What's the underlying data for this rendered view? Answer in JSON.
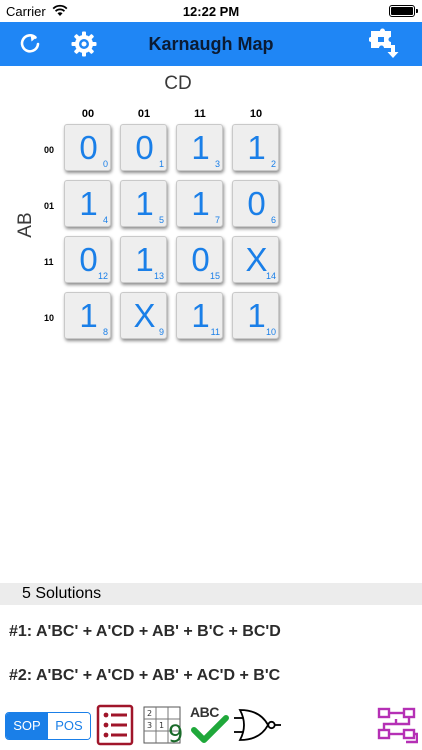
{
  "status_bar": {
    "carrier": "Carrier",
    "time": "12:22 PM"
  },
  "nav": {
    "title": "Karnaugh Map"
  },
  "map": {
    "col_var": "CD",
    "row_var": "AB",
    "col_labels": [
      "00",
      "01",
      "11",
      "10"
    ],
    "row_labels": [
      "00",
      "01",
      "11",
      "10"
    ],
    "cells": [
      [
        {
          "value": "0",
          "index": "0"
        },
        {
          "value": "0",
          "index": "1"
        },
        {
          "value": "1",
          "index": "3"
        },
        {
          "value": "1",
          "index": "2"
        }
      ],
      [
        {
          "value": "1",
          "index": "4"
        },
        {
          "value": "1",
          "index": "5"
        },
        {
          "value": "1",
          "index": "7"
        },
        {
          "value": "0",
          "index": "6"
        }
      ],
      [
        {
          "value": "0",
          "index": "12"
        },
        {
          "value": "1",
          "index": "13"
        },
        {
          "value": "0",
          "index": "15"
        },
        {
          "value": "X",
          "index": "14"
        }
      ],
      [
        {
          "value": "1",
          "index": "8"
        },
        {
          "value": "X",
          "index": "9"
        },
        {
          "value": "1",
          "index": "11"
        },
        {
          "value": "1",
          "index": "10"
        }
      ]
    ]
  },
  "solutions": {
    "count_label": "5 Solutions",
    "items": [
      {
        "label": "#1:",
        "expression": "A'BC' + A'CD + AB' + B'C + BC'D"
      },
      {
        "label": "#2:",
        "expression": "A'BC' + A'CD + AB' + AC'D + B'C"
      }
    ]
  },
  "toolbar": {
    "sop_label": "SOP",
    "pos_label": "POS",
    "sudoku_digit": "9",
    "spell_label": "ABC"
  },
  "colors": {
    "accent": "#1f86f5",
    "cell_text": "#1a7fe8",
    "list_icon": "#a0152a",
    "circuit_icon": "#b530b5"
  }
}
